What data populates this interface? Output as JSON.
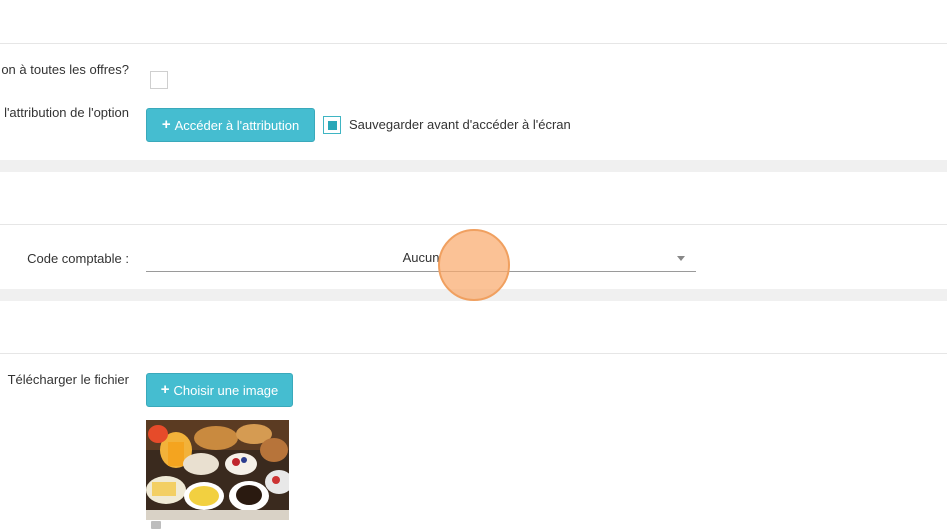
{
  "section1": {
    "offers_label": "on à toutes les offres?",
    "offers_checked": false,
    "attribution_label": "l'attribution de l'option",
    "access_button_label": "Accéder à l'attribution",
    "save_before_checked": true,
    "save_before_label": "Sauvegarder avant d'accéder à l'écran"
  },
  "section2": {
    "code_label": "Code comptable :",
    "code_value": "Aucun"
  },
  "section3": {
    "download_label": "Télécharger le fichier",
    "choose_image_label": "Choisir une image",
    "image_icon": "breakfast-photo"
  },
  "icons": {
    "plus": "+",
    "caret": "caret-down-icon"
  },
  "colors": {
    "accent": "#45bdd0",
    "cursor_highlight": "#f9b27a"
  }
}
